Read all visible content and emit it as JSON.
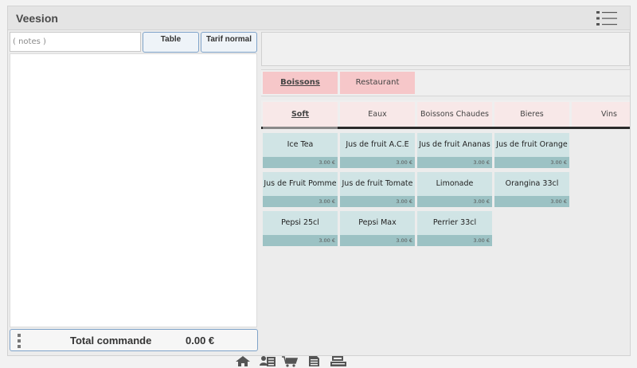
{
  "app": {
    "title": "Veesion"
  },
  "order": {
    "notes_placeholder": "( notes )",
    "table_label": "Table",
    "tarif_label": "Tarif normal",
    "total_label": "Total commande",
    "total_value": "0.00 €"
  },
  "categories": [
    {
      "label": "Boissons",
      "active": true
    },
    {
      "label": "Restaurant",
      "active": false
    }
  ],
  "subcategories": [
    {
      "label": "Soft",
      "active": true
    },
    {
      "label": "Eaux",
      "active": false
    },
    {
      "label": "Boissons Chaudes",
      "active": false
    },
    {
      "label": "Bieres",
      "active": false
    },
    {
      "label": "Vins",
      "active": false
    }
  ],
  "products": [
    {
      "name": "Ice Tea",
      "price": "3.00 €"
    },
    {
      "name": "Jus de fruit A.C.E",
      "price": "3.00 €"
    },
    {
      "name": "Jus de fruit Ananas",
      "price": "3.00 €"
    },
    {
      "name": "Jus de fruit Orange",
      "price": "3.00 €"
    },
    {
      "name": "Jus de Fruit Pomme",
      "price": "3.00 €"
    },
    {
      "name": "Jus de fruit Tomate",
      "price": "3.00 €"
    },
    {
      "name": "Limonade",
      "price": "3.00 €"
    },
    {
      "name": "Orangina 33cl",
      "price": "3.00 €"
    },
    {
      "name": "Pepsi 25cl",
      "price": "3.00 €"
    },
    {
      "name": "Pepsi Max",
      "price": "3.00 €"
    },
    {
      "name": "Perrier 33cl",
      "price": "3.00 €"
    }
  ],
  "toolbar_icons": [
    "home-icon",
    "customer-card-icon",
    "cart-icon",
    "receipt-icon",
    "cash-register-icon"
  ],
  "colors": {
    "category_bg": "#f6c7c9",
    "product_bg": "#d0e4e5",
    "price_bg": "#9cc2c4",
    "accent_border": "#7fa3c9"
  }
}
